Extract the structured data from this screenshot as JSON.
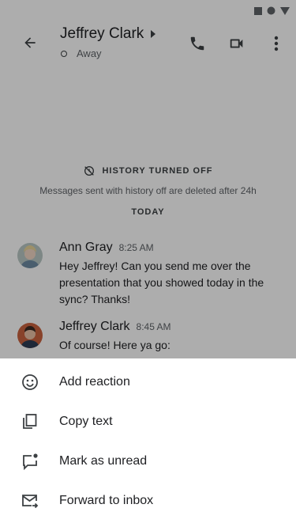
{
  "header": {
    "title": "Jeffrey Clark",
    "presence": "Away"
  },
  "conversation": {
    "history_label": "HISTORY TURNED OFF",
    "history_description": "Messages sent with history off are deleted after 24h",
    "date_divider": "TODAY",
    "messages": [
      {
        "sender": "Ann Gray",
        "time": "8:25 AM",
        "text": "Hey Jeffrey! Can you send me over the presentation that you showed today in the sync? Thanks!"
      },
      {
        "sender": "Jeffrey Clark",
        "time": "8:45 AM",
        "text": "Of course! Here ya go:"
      }
    ]
  },
  "sheet": {
    "items": [
      {
        "label": "Add reaction",
        "icon": "smiley-icon"
      },
      {
        "label": "Copy text",
        "icon": "copy-icon"
      },
      {
        "label": "Mark as unread",
        "icon": "mark-unread-icon"
      },
      {
        "label": "Forward to inbox",
        "icon": "forward-to-inbox-icon"
      }
    ]
  },
  "colors": {
    "scrim": "#00000052",
    "text_primary": "#202124",
    "text_secondary": "#5f6368",
    "icon": "#3c4043"
  }
}
